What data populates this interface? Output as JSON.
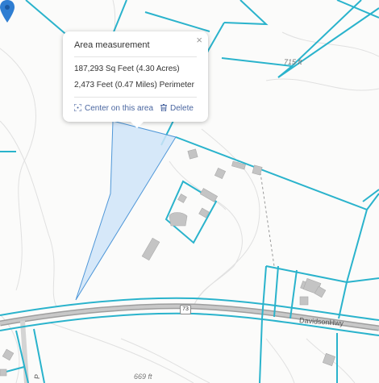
{
  "popup": {
    "title": "Area measurement",
    "close_glyph": "×",
    "area": "187,293 Sq Feet (4.30 Acres)",
    "perimeter": "2,473 Feet (0.47 Miles) Perimeter",
    "center_label": "Center on this area",
    "delete_label": "Delete",
    "center_icon": "center-crosshair-icon",
    "delete_icon": "trash-icon"
  },
  "map": {
    "contour_labels": [
      "715 ft",
      "669 ft"
    ],
    "road_name": "DavidsonHwy",
    "route_number": "73",
    "side_road_letter": "P",
    "colors": {
      "parcel_line": "#2ab3cc",
      "measured_fill": "#cfe4f8",
      "measured_stroke": "#4f97d8",
      "marker": "#2f7ed2",
      "road": "#a7a7a7"
    }
  }
}
